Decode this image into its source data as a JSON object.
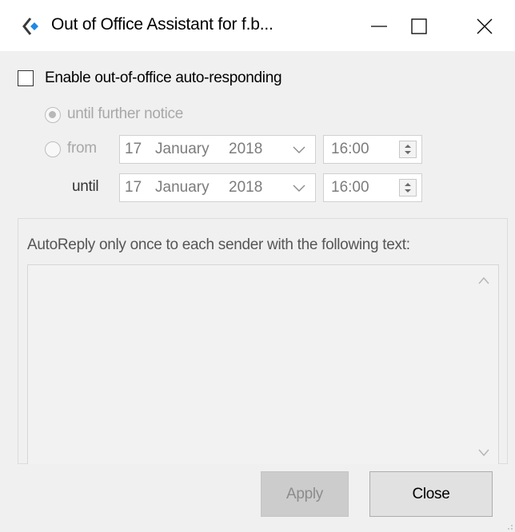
{
  "window": {
    "title": "Out of Office Assistant for f.b...",
    "icons": {
      "app": "diamond-arrow-icon",
      "minimize": "minimize-icon",
      "maximize": "maximize-icon",
      "close": "close-icon"
    }
  },
  "enable": {
    "label": "Enable out-of-office auto-responding",
    "checked": false
  },
  "schedule": {
    "until_further_notice": {
      "label": "until further notice",
      "selected": true
    },
    "from": {
      "label": "from",
      "selected": false,
      "date": {
        "day": "17",
        "month": "January",
        "year": "2018"
      },
      "time": "16:00"
    },
    "until": {
      "label": "until",
      "date": {
        "day": "17",
        "month": "January",
        "year": "2018"
      },
      "time": "16:00"
    }
  },
  "autoreply": {
    "label": "AutoReply only once to each sender with the following text:",
    "text": ""
  },
  "buttons": {
    "apply": "Apply",
    "close": "Close"
  },
  "colors": {
    "accent": "#1e88e5",
    "disabled_text": "#a8a8a8",
    "background": "#f0f0f0"
  }
}
